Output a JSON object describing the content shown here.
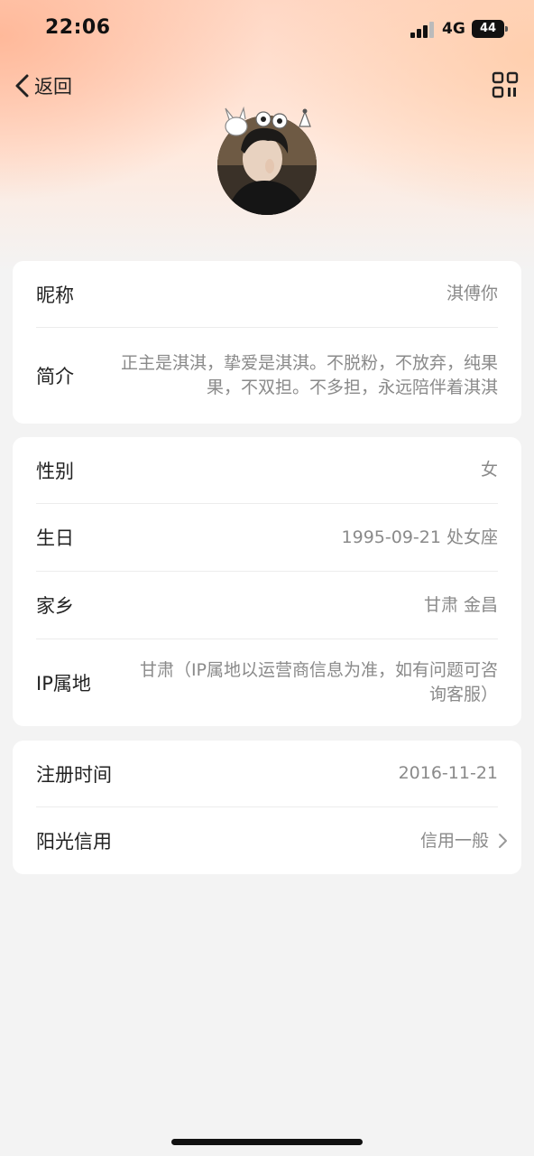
{
  "status_bar": {
    "time": "22:06",
    "network": "4G",
    "battery": "44"
  },
  "nav": {
    "back_label": "返回",
    "back_icon": "chevron-left-icon",
    "qr_icon": "qr-code-icon"
  },
  "profile": {
    "avatar_icon": "avatar-photo"
  },
  "basic_info": {
    "nickname_label": "昵称",
    "nickname_value": "淇傅你",
    "bio_label": "简介",
    "bio_value": "正主是淇淇，挚爱是淇淇。不脱粉，不放弃，纯果果，不双担。不多担，永远陪伴着淇淇"
  },
  "personal_info": {
    "gender_label": "性别",
    "gender_value": "女",
    "birthday_label": "生日",
    "birthday_value": "1995-09-21 处女座",
    "hometown_label": "家乡",
    "hometown_value": "甘肃 金昌",
    "ip_label": "IP属地",
    "ip_value": "甘肃（IP属地以运营商信息为准，如有问题可咨询客服）"
  },
  "account_info": {
    "register_label": "注册时间",
    "register_value": "2016-11-21",
    "credit_label": "阳光信用",
    "credit_value": "信用一般",
    "credit_icon": "chevron-right-icon"
  },
  "colors": {
    "header_gradient_top": "#ffd7c4",
    "background": "#f3f3f3",
    "value_text": "#8a8a8a"
  }
}
